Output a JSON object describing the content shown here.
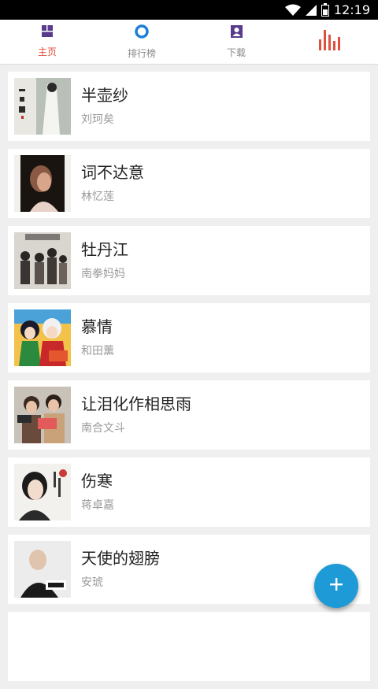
{
  "status_bar": {
    "time": "12:19"
  },
  "tabs": [
    {
      "label": "主页",
      "icon": "home-grid-icon",
      "active": true
    },
    {
      "label": "排行榜",
      "icon": "ring-icon",
      "active": false
    },
    {
      "label": "下载",
      "icon": "user-box-icon",
      "active": false
    },
    {
      "label": "",
      "icon": "equalizer-icon",
      "active": false
    }
  ],
  "songs": [
    {
      "title": "半壶纱",
      "artist": "刘珂矣"
    },
    {
      "title": "词不达意",
      "artist": "林忆莲"
    },
    {
      "title": "牡丹江",
      "artist": "南拳妈妈"
    },
    {
      "title": "慕情",
      "artist": "和田薰"
    },
    {
      "title": "让泪化作相思雨",
      "artist": "南合文斗"
    },
    {
      "title": "伤寒",
      "artist": "蒋卓嘉"
    },
    {
      "title": "天使的翅膀",
      "artist": "安琥"
    }
  ],
  "colors": {
    "accent": "#e0503f",
    "fab": "#1e9ad6",
    "tab_icon": "#5a3a8c"
  },
  "fab": {
    "icon": "plus-icon"
  }
}
